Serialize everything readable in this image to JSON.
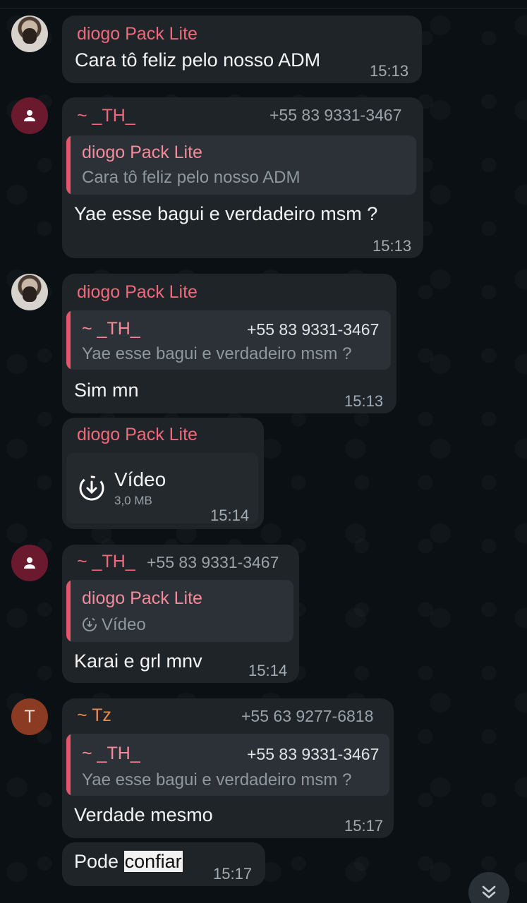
{
  "messages": {
    "m1": {
      "sender": "diogo Pack Lite",
      "text": "Cara tô feliz pelo nosso ADM",
      "time": "15:13"
    },
    "m2": {
      "sender": "~ _TH_",
      "phone": "+55 83 9331-3467",
      "quote": {
        "sender": "diogo Pack Lite",
        "text": "Cara tô feliz pelo nosso ADM"
      },
      "text": "Yae esse bagui e verdadeiro msm ?",
      "time": "15:13"
    },
    "m3": {
      "sender": "diogo Pack Lite",
      "quote": {
        "sender": "~ _TH_",
        "phone": "+55 83 9331-3467",
        "text": "Yae esse bagui e verdadeiro msm ?"
      },
      "text": "Sim mn",
      "time": "15:13"
    },
    "m4": {
      "sender": "diogo Pack Lite",
      "video_title": "Vídeo",
      "video_size": "3,0 MB",
      "time": "15:14"
    },
    "m5": {
      "sender": "~ _TH_",
      "phone": "+55 83 9331-3467",
      "quote": {
        "sender": "diogo Pack Lite",
        "text": "Vídeo"
      },
      "text": "Karai e grl mnv",
      "time": "15:14"
    },
    "m6": {
      "avatar_letter": "T",
      "sender": "~ Tz",
      "phone": "+55 63 9277-6818",
      "quote": {
        "sender": "~ _TH_",
        "phone": "+55 83 9331-3467",
        "text": "Yae esse bagui e verdadeiro msm ?"
      },
      "text": "Verdade mesmo",
      "time": "15:17"
    },
    "m7": {
      "text_before": "Pode ",
      "text_highlight": "confiar",
      "time": "15:17"
    }
  },
  "icons": {
    "person": "person-icon",
    "download": "download-icon",
    "scroll_down": "chevron-double-down-icon"
  },
  "colors": {
    "background": "#0b1014",
    "bubble": "#1f2428",
    "quote": "#2b3136",
    "sender_pink": "#f0687a",
    "sender_orange": "#f08a4b",
    "quote_bar": "#e5566b"
  }
}
